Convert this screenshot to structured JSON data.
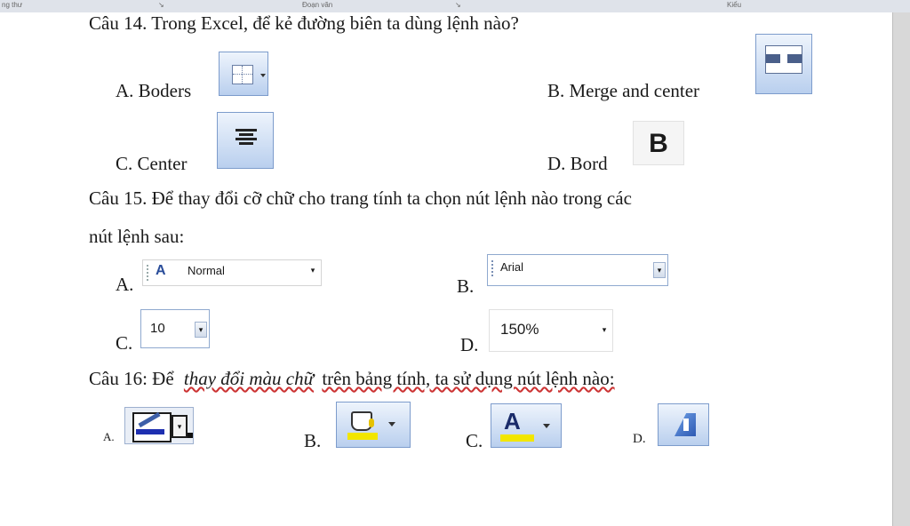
{
  "ribbon": {
    "label_left": "ng thư",
    "label_mid": "Đoạn văn",
    "label_right": "Kiểu"
  },
  "q14": {
    "question": "Câu 14. Trong Excel, để kẻ đường biên ta dùng lệnh nào?",
    "a": "A. Boders",
    "b": "B. Merge and center",
    "c": "C. Center",
    "d": "D. Bord",
    "bold_glyph": "B"
  },
  "q15": {
    "question_line1": "Câu 15. Để thay đổi cỡ chữ cho trang tính ta chọn nút lệnh nào trong các",
    "question_line2": "nút lệnh sau:",
    "a": "A.",
    "a_value": "Normal",
    "b": "B.",
    "b_value": "Arial",
    "c": "C.",
    "c_value": "10",
    "d": "D.",
    "d_value": "150%"
  },
  "q16": {
    "question_prefix": "Câu 16: Để",
    "question_italic": "thay đổi màu chữ",
    "question_suffix": "trên bảng tính, ta sử dụng nút lệnh nào:",
    "a": "A.",
    "b": "B.",
    "c": "C.",
    "d": "D.",
    "font_color_glyph": "A"
  },
  "colors": {
    "page": "#ffffff",
    "toolbar_blue": "#b9cfee",
    "accent_yellow": "#f2e600"
  }
}
